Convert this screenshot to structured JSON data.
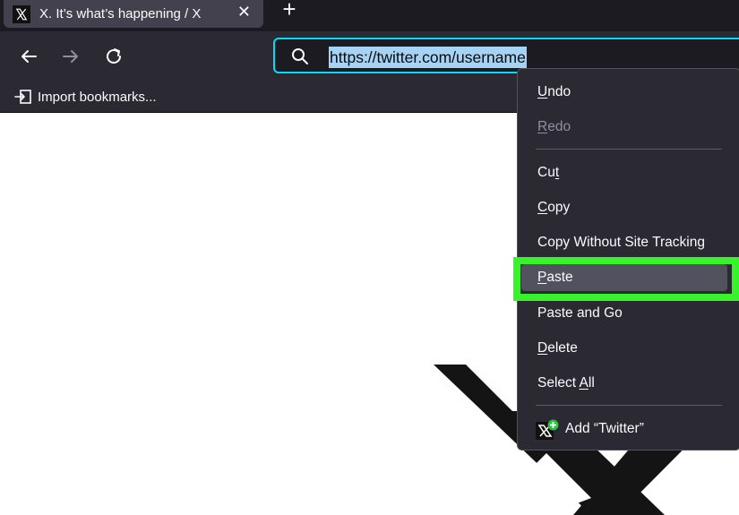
{
  "tab": {
    "title": "X. It’s what’s happening / X",
    "close_glyph": "✕",
    "favicon": "x-logo-icon"
  },
  "new_tab_glyph": "+",
  "nav": {
    "back_icon": "back-arrow-icon",
    "forward_icon": "forward-arrow-icon",
    "reload_icon": "reload-icon"
  },
  "urlbar": {
    "value": "https://twitter.com/username",
    "search_icon": "search-icon"
  },
  "bookmarks": {
    "import_label": "Import bookmarks..."
  },
  "context_menu": {
    "undo": {
      "label": "Undo",
      "accel": "U",
      "rest": "ndo"
    },
    "redo": {
      "label": "Redo",
      "accel": "R",
      "rest": "edo",
      "disabled": true
    },
    "cut": {
      "label": "Cut",
      "pre": "Cu",
      "accel": "t"
    },
    "copy": {
      "label": "Copy",
      "accel": "C",
      "rest": "opy"
    },
    "copy_without_tracking": {
      "label": "Copy Without Site Tracking"
    },
    "paste": {
      "label": "Paste",
      "accel": "P",
      "rest": "aste",
      "highlighted": true
    },
    "paste_and_go": {
      "label": "Paste and Go"
    },
    "delete": {
      "label": "Delete",
      "accel": "D",
      "rest": "elete"
    },
    "select_all": {
      "label": "Select All",
      "pre": "Select ",
      "accel": "A",
      "rest": "ll"
    },
    "add_search": {
      "label": "Add “Twitter”"
    }
  },
  "colors": {
    "highlight_box": "#38f22c",
    "urlbar_focus": "#00ddff",
    "selection": "#a6d2f4",
    "menu_bg": "#2b2a33",
    "toolbar_bg": "#2b2a33",
    "tabstrip_bg": "#1c1b22"
  }
}
